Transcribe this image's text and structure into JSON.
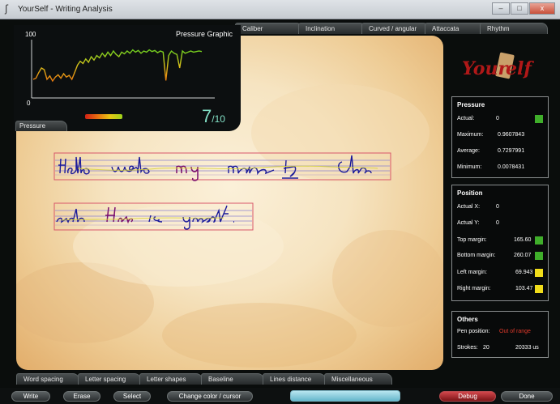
{
  "window": {
    "title": "YourSelf - Writing Analysis",
    "app_icon": "yourself-app-icon",
    "buttons": {
      "minimize": "–",
      "maximize": "□",
      "close": "x"
    }
  },
  "top_tabs": [
    "Caliber",
    "Inclination",
    "Curved / angular",
    "Attaccata",
    "Rhythm"
  ],
  "pressure_graphic": {
    "title": "Pressure Graphic",
    "y_max_label": "100",
    "y_min_label": "0",
    "tab_label": "Pressure",
    "score": "7",
    "score_denominator": "/10",
    "gradient_colors": [
      "#d12015",
      "#e86f10",
      "#e8c613",
      "#9ed21c"
    ]
  },
  "chart_data": {
    "type": "line",
    "title": "Pressure Graphic",
    "ylim": [
      0,
      100
    ],
    "values": [
      30,
      32,
      42,
      50,
      47,
      30,
      36,
      27,
      34,
      38,
      32,
      40,
      34,
      37,
      30,
      42,
      55,
      62,
      58,
      66,
      60,
      70,
      64,
      72,
      68,
      76,
      70,
      78,
      72,
      80,
      74,
      70,
      78,
      75,
      80,
      76,
      82,
      78,
      81,
      76,
      80,
      78,
      82,
      79,
      81,
      77,
      80,
      78,
      28,
      72,
      80,
      76,
      74,
      50,
      80,
      76,
      78,
      80,
      78,
      79,
      80,
      79
    ]
  },
  "logo": {
    "text": "YourSelf"
  },
  "pressure_panel": {
    "title": "Pressure",
    "actual_label": "Actual:",
    "actual_value": "0",
    "actual_color": "#3fae2a",
    "maximum_label": "Maximum:",
    "maximum_value": "0.9607843",
    "average_label": "Average:",
    "average_value": "0.7297991",
    "minimum_label": "Minimum:",
    "minimum_value": "0.0078431"
  },
  "position_panel": {
    "title": "Position",
    "actual_x_label": "Actual X:",
    "actual_x_value": "0",
    "actual_y_label": "Actual Y:",
    "actual_y_value": "0",
    "top_margin_label": "Top margin:",
    "top_margin_value": "165.60",
    "top_margin_color": "#3fae2a",
    "bottom_margin_label": "Bottom margin:",
    "bottom_margin_value": "260.07",
    "bottom_margin_color": "#3fae2a",
    "left_margin_label": "Left margin:",
    "left_margin_value": "69.943",
    "left_margin_color": "#f0dc1a",
    "right_margin_label": "Right margin:",
    "right_margin_value": "103.47",
    "right_margin_color": "#f0dc1a"
  },
  "others_panel": {
    "title": "Others",
    "pen_position_label": "Pen position:",
    "pen_position_value": "Out of range",
    "pen_position_color": "#e23a2b",
    "strokes_label": "Strokes:",
    "strokes_value": "20",
    "time_value": "20333 us"
  },
  "bottom_tabs": [
    "Word spacing",
    "Letter spacing",
    "Letter shapes",
    "Baseline",
    "Lines distance",
    "Miscellaneous"
  ],
  "actions": {
    "write": "Write",
    "erase": "Erase",
    "select": "Select",
    "change_color": "Change color / cursor",
    "debug": "Debug",
    "done": "Done"
  }
}
